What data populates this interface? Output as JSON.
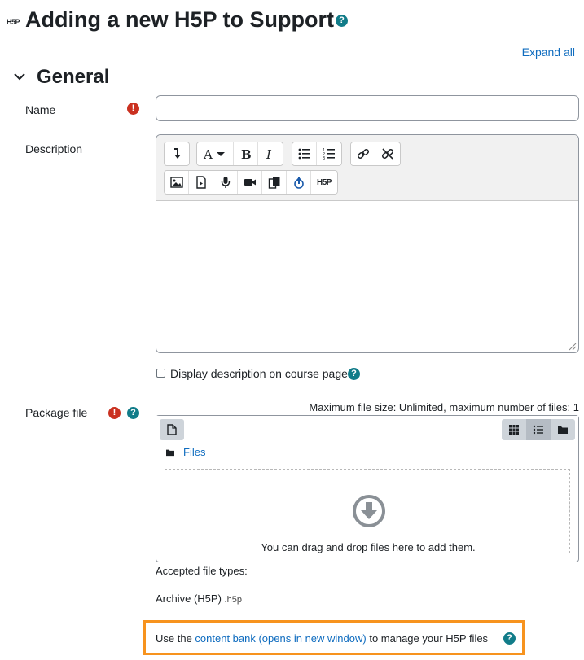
{
  "page": {
    "title_icon_text": "H5P",
    "title": "Adding a new H5P to Support",
    "help_glyph": "?",
    "expand_all": "Expand all"
  },
  "section": {
    "title": "General"
  },
  "form": {
    "name_label": "Name",
    "name_value": "",
    "required_glyph": "!",
    "description_label": "Description",
    "editor_h5p_label": "H5P",
    "display_desc_label": "Display description on course page",
    "package_label": "Package file",
    "max_size_text": "Maximum file size: Unlimited, maximum number of files: 1",
    "files_breadcrumb": "Files",
    "dropzone_text": "You can drag and drop files here to add them.",
    "accepted_label": "Accepted file types:",
    "archive_type": "Archive (H5P)",
    "archive_ext": ".h5p",
    "bank_prefix": "Use the ",
    "bank_link": "content bank (opens in new window)",
    "bank_suffix": " to manage your H5P files"
  },
  "colors": {
    "link": "#0f6cbf",
    "required": "#ca3120",
    "help": "#117c89",
    "highlight": "#f7931e"
  }
}
